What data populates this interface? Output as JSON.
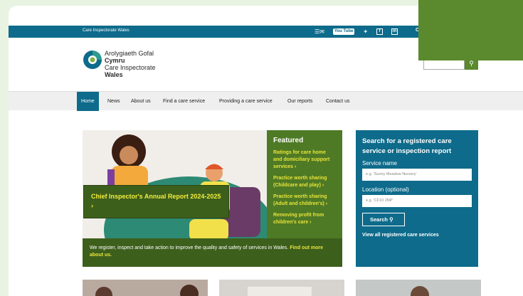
{
  "topbar": {
    "site_name": "Care Inspectorate Wales",
    "social": [
      "email-icon",
      "youtube-icon",
      "twitter-icon",
      "facebook-icon",
      "linkedin-icon"
    ],
    "youtube_label": "You Tube",
    "facebook_glyph": "f",
    "linkedin_glyph": "in",
    "lang_prefix": "C"
  },
  "logo": {
    "line1": "Arolygiaeth Gofal",
    "line2": "Cymru",
    "line3": "Care Inspectorate",
    "line4": "Wales"
  },
  "search": {
    "icon": "search-icon"
  },
  "nav": {
    "items": [
      "Home",
      "News",
      "About us",
      "Find a care service",
      "Providing a care service",
      "Our reports",
      "Contact us"
    ],
    "active": "Home"
  },
  "hero": {
    "report_title": "Chief Inspector's Annual Report 2024-2025",
    "intro": "We register, inspect and take action to improve the quality and safety of services in Wales.",
    "intro_link": "Find out more about us."
  },
  "featured": {
    "title": "Featured",
    "items": [
      "Ratings for care home and domiciliary support services",
      "Practice worth sharing (Childcare and play)",
      "Practice worth sharing (Adult and children's)",
      "Removing profit from children's care"
    ]
  },
  "side_search": {
    "title": "Search for a registered care service or inspection report",
    "service_label": "Service name",
    "service_placeholder": "e.g. 'Sunny Meadow Nursery'",
    "location_label": "Location (optional)",
    "location_placeholder": "e.g. 'CF10 2NP'",
    "button": "Search",
    "view_all": "View all registered care services"
  },
  "colors": {
    "brand_blue": "#0e6b8b",
    "brand_green": "#4f7a25",
    "dark_green": "#3d5f1c",
    "link_yellow": "#e8e43a"
  }
}
